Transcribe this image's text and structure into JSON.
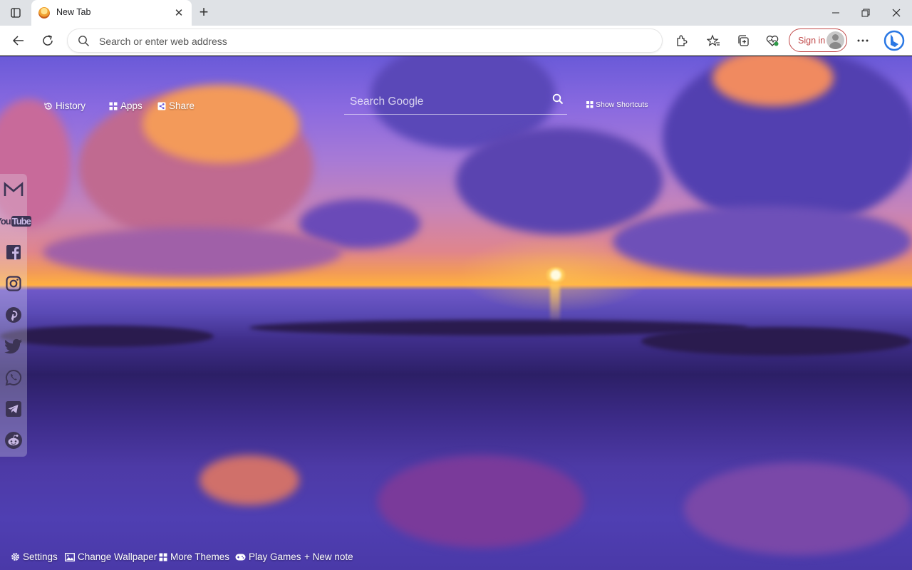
{
  "tab": {
    "title": "New Tab"
  },
  "omnibox": {
    "placeholder": "Search or enter web address"
  },
  "toolbar": {
    "signin_label": "Sign in"
  },
  "newtab_page": {
    "nav": {
      "history": "History",
      "apps": "Apps",
      "share": "Share"
    },
    "search": {
      "placeholder": "Search Google"
    },
    "shortcuts_label": "Show Shortcuts",
    "social": [
      "gmail-icon",
      "youtube-icon",
      "facebook-icon",
      "instagram-icon",
      "pinterest-icon",
      "twitter-icon",
      "whatsapp-icon",
      "telegram-icon",
      "reddit-icon"
    ],
    "youtube_text": {
      "you": "You",
      "tube": "Tube"
    },
    "bottom": {
      "settings": "Settings",
      "change_wallpaper": "Change Wallpaper",
      "more_themes": "More Themes",
      "play_games": "Play Games",
      "new_note": "+ New note"
    }
  },
  "colors": {
    "signin_border": "#c04848",
    "bing_blue": "#1a73e8",
    "chrome_bg": "#dfe2e6"
  }
}
